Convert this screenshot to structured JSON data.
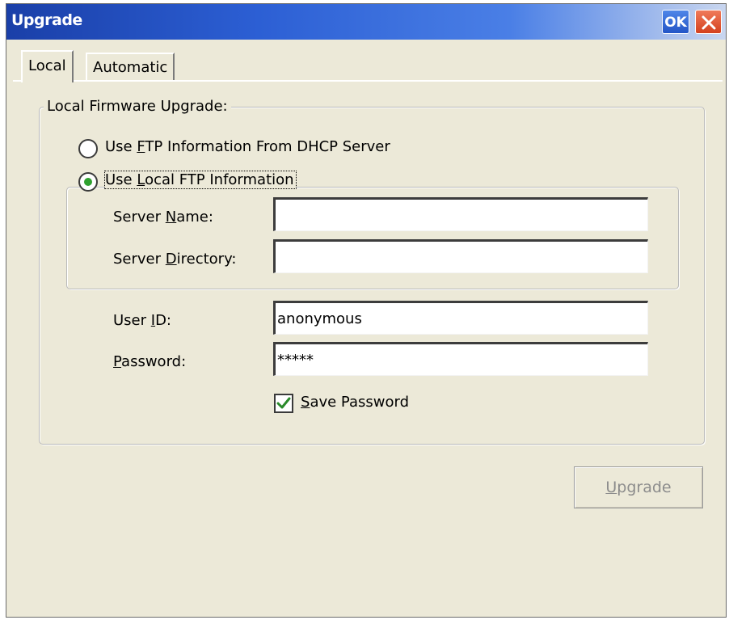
{
  "window": {
    "title": "Upgrade",
    "ok_label": "OK"
  },
  "tabs": [
    {
      "label": "Local",
      "active": true
    },
    {
      "label": "Automatic",
      "active": false
    }
  ],
  "group": {
    "label": "Local Firmware Upgrade:"
  },
  "options": {
    "dhcp": {
      "pre": "Use ",
      "mnemonic": "F",
      "post": "TP Information From DHCP Server",
      "selected": false
    },
    "local": {
      "pre": "Use ",
      "mnemonic": "L",
      "post": "ocal FTP Information",
      "selected": true
    }
  },
  "fields": {
    "server_name": {
      "pre": "Server ",
      "mnemonic": "N",
      "post": "ame:",
      "value": ""
    },
    "server_directory": {
      "pre": "Server ",
      "mnemonic": "D",
      "post": "irectory:",
      "value": ""
    },
    "user_id": {
      "pre": "User ",
      "mnemonic": "I",
      "post": "D:",
      "value": "anonymous"
    },
    "password": {
      "pre": "",
      "mnemonic": "P",
      "post": "assword:",
      "value": "*****"
    }
  },
  "save_password": {
    "pre": "",
    "mnemonic": "S",
    "post": "ave Password",
    "checked": true
  },
  "upgrade_button": {
    "pre": "",
    "mnemonic": "U",
    "post": "pgrade",
    "enabled": false
  },
  "colors": {
    "title_gradient_start": "#1a3fa8",
    "title_gradient_end": "#c9d6ef",
    "dialog_bg": "#ece9d8",
    "radio_dot": "#2fa12f",
    "check_mark": "#2a8a2a",
    "close_button": "#d4411e"
  },
  "icons": {
    "close": "close-icon",
    "check": "check-icon"
  }
}
